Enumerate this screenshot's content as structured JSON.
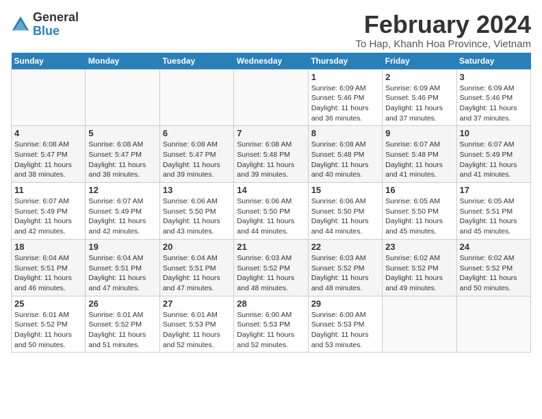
{
  "header": {
    "logo_general": "General",
    "logo_blue": "Blue",
    "month_title": "February 2024",
    "location": "To Hap, Khanh Hoa Province, Vietnam"
  },
  "weekdays": [
    "Sunday",
    "Monday",
    "Tuesday",
    "Wednesday",
    "Thursday",
    "Friday",
    "Saturday"
  ],
  "weeks": [
    [
      {
        "day": "",
        "info": ""
      },
      {
        "day": "",
        "info": ""
      },
      {
        "day": "",
        "info": ""
      },
      {
        "day": "",
        "info": ""
      },
      {
        "day": "1",
        "info": "Sunrise: 6:09 AM\nSunset: 5:46 PM\nDaylight: 11 hours and 36 minutes."
      },
      {
        "day": "2",
        "info": "Sunrise: 6:09 AM\nSunset: 5:46 PM\nDaylight: 11 hours and 37 minutes."
      },
      {
        "day": "3",
        "info": "Sunrise: 6:09 AM\nSunset: 5:46 PM\nDaylight: 11 hours and 37 minutes."
      }
    ],
    [
      {
        "day": "4",
        "info": "Sunrise: 6:08 AM\nSunset: 5:47 PM\nDaylight: 11 hours and 38 minutes."
      },
      {
        "day": "5",
        "info": "Sunrise: 6:08 AM\nSunset: 5:47 PM\nDaylight: 11 hours and 38 minutes."
      },
      {
        "day": "6",
        "info": "Sunrise: 6:08 AM\nSunset: 5:47 PM\nDaylight: 11 hours and 39 minutes."
      },
      {
        "day": "7",
        "info": "Sunrise: 6:08 AM\nSunset: 5:48 PM\nDaylight: 11 hours and 39 minutes."
      },
      {
        "day": "8",
        "info": "Sunrise: 6:08 AM\nSunset: 5:48 PM\nDaylight: 11 hours and 40 minutes."
      },
      {
        "day": "9",
        "info": "Sunrise: 6:07 AM\nSunset: 5:48 PM\nDaylight: 11 hours and 41 minutes."
      },
      {
        "day": "10",
        "info": "Sunrise: 6:07 AM\nSunset: 5:49 PM\nDaylight: 11 hours and 41 minutes."
      }
    ],
    [
      {
        "day": "11",
        "info": "Sunrise: 6:07 AM\nSunset: 5:49 PM\nDaylight: 11 hours and 42 minutes."
      },
      {
        "day": "12",
        "info": "Sunrise: 6:07 AM\nSunset: 5:49 PM\nDaylight: 11 hours and 42 minutes."
      },
      {
        "day": "13",
        "info": "Sunrise: 6:06 AM\nSunset: 5:50 PM\nDaylight: 11 hours and 43 minutes."
      },
      {
        "day": "14",
        "info": "Sunrise: 6:06 AM\nSunset: 5:50 PM\nDaylight: 11 hours and 44 minutes."
      },
      {
        "day": "15",
        "info": "Sunrise: 6:06 AM\nSunset: 5:50 PM\nDaylight: 11 hours and 44 minutes."
      },
      {
        "day": "16",
        "info": "Sunrise: 6:05 AM\nSunset: 5:50 PM\nDaylight: 11 hours and 45 minutes."
      },
      {
        "day": "17",
        "info": "Sunrise: 6:05 AM\nSunset: 5:51 PM\nDaylight: 11 hours and 45 minutes."
      }
    ],
    [
      {
        "day": "18",
        "info": "Sunrise: 6:04 AM\nSunset: 5:51 PM\nDaylight: 11 hours and 46 minutes."
      },
      {
        "day": "19",
        "info": "Sunrise: 6:04 AM\nSunset: 5:51 PM\nDaylight: 11 hours and 47 minutes."
      },
      {
        "day": "20",
        "info": "Sunrise: 6:04 AM\nSunset: 5:51 PM\nDaylight: 11 hours and 47 minutes."
      },
      {
        "day": "21",
        "info": "Sunrise: 6:03 AM\nSunset: 5:52 PM\nDaylight: 11 hours and 48 minutes."
      },
      {
        "day": "22",
        "info": "Sunrise: 6:03 AM\nSunset: 5:52 PM\nDaylight: 11 hours and 48 minutes."
      },
      {
        "day": "23",
        "info": "Sunrise: 6:02 AM\nSunset: 5:52 PM\nDaylight: 11 hours and 49 minutes."
      },
      {
        "day": "24",
        "info": "Sunrise: 6:02 AM\nSunset: 5:52 PM\nDaylight: 11 hours and 50 minutes."
      }
    ],
    [
      {
        "day": "25",
        "info": "Sunrise: 6:01 AM\nSunset: 5:52 PM\nDaylight: 11 hours and 50 minutes."
      },
      {
        "day": "26",
        "info": "Sunrise: 6:01 AM\nSunset: 5:52 PM\nDaylight: 11 hours and 51 minutes."
      },
      {
        "day": "27",
        "info": "Sunrise: 6:01 AM\nSunset: 5:53 PM\nDaylight: 11 hours and 52 minutes."
      },
      {
        "day": "28",
        "info": "Sunrise: 6:00 AM\nSunset: 5:53 PM\nDaylight: 11 hours and 52 minutes."
      },
      {
        "day": "29",
        "info": "Sunrise: 6:00 AM\nSunset: 5:53 PM\nDaylight: 11 hours and 53 minutes."
      },
      {
        "day": "",
        "info": ""
      },
      {
        "day": "",
        "info": ""
      }
    ]
  ]
}
